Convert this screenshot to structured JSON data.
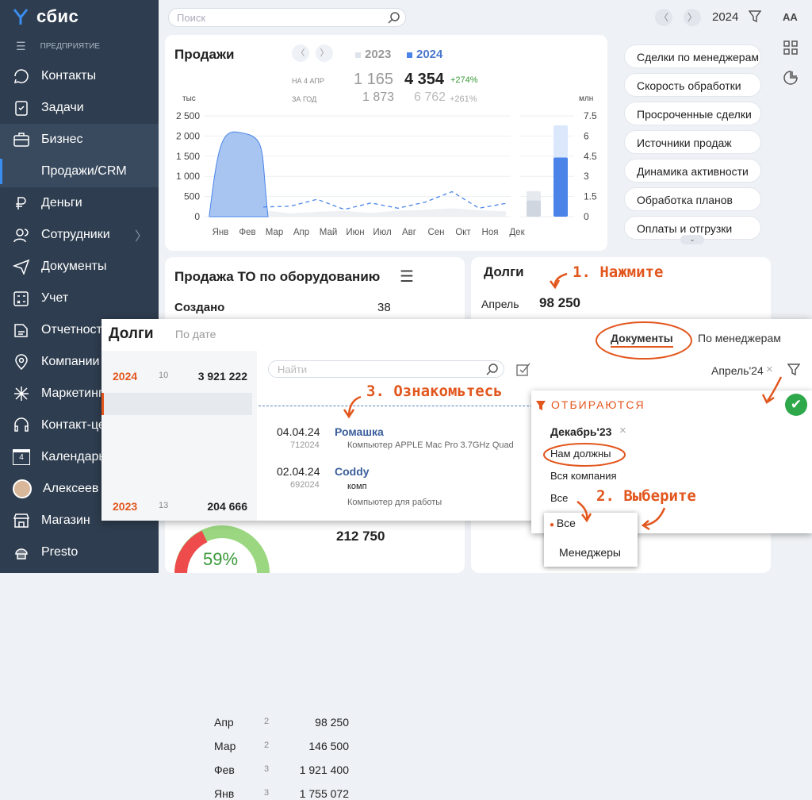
{
  "app": {
    "logo": "сбис",
    "section_caption": "ПРЕДПРИЯТИЕ"
  },
  "sidebar": {
    "items": [
      {
        "label": "Контакты",
        "icon": "contacts-icon"
      },
      {
        "label": "Задачи",
        "icon": "tasks-icon"
      },
      {
        "label": "Бизнес",
        "icon": "briefcase-icon"
      },
      {
        "label": "Продажи/CRM"
      },
      {
        "label": "Деньги",
        "icon": "money-icon"
      },
      {
        "label": "Сотрудники",
        "icon": "employees-icon"
      },
      {
        "label": "Документы",
        "icon": "documents-icon"
      },
      {
        "label": "Учет",
        "icon": "accounting-icon"
      },
      {
        "label": "Отчетность",
        "icon": "reports-icon"
      },
      {
        "label": "Компании",
        "icon": "companies-icon"
      },
      {
        "label": "Маркетинг",
        "icon": "marketing-icon"
      },
      {
        "label": "Контакт-центр",
        "icon": "contact-center-icon"
      },
      {
        "label": "Календарь",
        "icon": "calendar-icon",
        "badge": "4"
      },
      {
        "label": "Алексеев",
        "icon": "avatar"
      },
      {
        "label": "Магазин",
        "icon": "store-icon"
      },
      {
        "label": "Presto",
        "icon": "presto-icon"
      }
    ]
  },
  "topbar": {
    "search_placeholder": "Поиск",
    "year": "2024"
  },
  "sales": {
    "title": "Продажи",
    "y2023": "2023",
    "y2024": "2024",
    "row1_label": "НА 4 АПР",
    "row1_prev": "1 165",
    "row1_cur": "4 354",
    "row1_pct": "+274%",
    "row2_label": "ЗА ГОД",
    "row2_prev": "1 873",
    "row2_cur": "6 762",
    "row2_pct": "+261%",
    "unit_left": "тыс",
    "unit_right": "млн"
  },
  "chart_data": {
    "type": "area",
    "title": "Продажи",
    "ylabel": "тыс",
    "ylim": [
      0,
      2500
    ],
    "categories": [
      "Янв",
      "Фев",
      "Мар",
      "Апр",
      "Май",
      "Июн",
      "Июл",
      "Авг",
      "Сен",
      "Окт",
      "Ноя",
      "Дек"
    ],
    "y_ticks": [
      "2 500",
      "2 000",
      "1 500",
      "1 000",
      "500",
      "0"
    ],
    "series": [
      {
        "name": "2024",
        "values": [
          40,
          2100,
          1900,
          0,
          0,
          0,
          0,
          0,
          0,
          0,
          0,
          0
        ]
      },
      {
        "name": "2023",
        "values": [
          130,
          220,
          160,
          80,
          120,
          140,
          90,
          150,
          170,
          210,
          160,
          130
        ]
      },
      {
        "name": "2023",
        "values": [
          120,
          260,
          240,
          260,
          430,
          180,
          340,
          210,
          360,
          620,
          210,
          330
        ]
      }
    ],
    "bars": {
      "ylabel": "млн",
      "ylim": [
        0,
        7.5
      ],
      "y_ticks": [
        "7.5",
        "6",
        "4.5",
        "3",
        "1.5",
        "0"
      ],
      "series": [
        {
          "name": "2023",
          "values": [
            1.9,
            1.2
          ]
        },
        {
          "name": "2024",
          "values": [
            6.8,
            4.4
          ]
        }
      ]
    }
  },
  "reports": [
    "Сделки по менеджерам",
    "Скорость обработки",
    "Просроченные сделки",
    "Источники продаж",
    "Динамика активности",
    "Обработка планов",
    "Оплаты и отгрузки"
  ],
  "equipment": {
    "title": "Продажа ТО по оборудованию",
    "created_label": "Создано",
    "created_value": "38",
    "sum": "212 750",
    "percent": "59%"
  },
  "debts_card": {
    "title": "Долги",
    "month": "Апрель",
    "value": "98 250"
  },
  "panel": {
    "title": "Долги",
    "by_date": "По дате",
    "tab_docs": "Документы",
    "tab_managers": "По менеджерам",
    "search_placeholder": "Найти",
    "period": "Апрель'24",
    "years": [
      {
        "year": "2024",
        "count": "10",
        "sum": "3 921 222"
      },
      {
        "year": "2023",
        "count": "13",
        "sum": "204 666"
      }
    ],
    "months": [
      {
        "name": "Апр",
        "count": "2",
        "sum": "98 250"
      },
      {
        "name": "Мар",
        "count": "2",
        "sum": "146 500"
      },
      {
        "name": "Фев",
        "count": "3",
        "sum": "1 921 400"
      },
      {
        "name": "Янв",
        "count": "3",
        "sum": "1 755 072"
      }
    ],
    "docs": [
      {
        "date": "04.04.24",
        "num": "712024",
        "name": "Ромашка",
        "desc": "Компьютер APPLE Mac Pro 3.7GHz Quad"
      },
      {
        "date": "02.04.24",
        "num": "692024",
        "name": "Coddy",
        "sub": "комп",
        "desc": "Компьютер для работы"
      }
    ]
  },
  "filter": {
    "title": "ОТБИРАЮТСЯ",
    "date": "Декабрь'23",
    "opt1": "Нам должны",
    "opt2": "Вся компания",
    "opt3": "Все",
    "menu": [
      "Все",
      "Менеджеры"
    ]
  },
  "annotations": {
    "a1": "1. Нажмите",
    "a2": "2. Выберите",
    "a3": "3. Ознакомьтесь"
  }
}
